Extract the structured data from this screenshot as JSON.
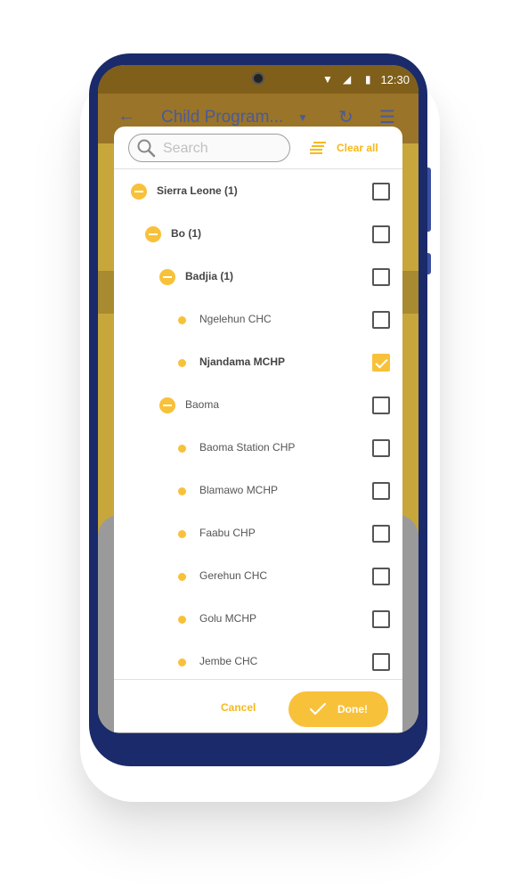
{
  "status_bar": {
    "time": "12:30"
  },
  "background_app": {
    "title": "Child Program..."
  },
  "dialog": {
    "search": {
      "placeholder": "Search",
      "value": ""
    },
    "clear_all_label": "Clear all",
    "tree": [
      {
        "label": "Sierra Leone (1)",
        "level": 0,
        "kind": "expanded",
        "bold": true,
        "checked": false
      },
      {
        "label": "Bo (1)",
        "level": 1,
        "kind": "expanded",
        "bold": true,
        "checked": false
      },
      {
        "label": "Badjia (1)",
        "level": 2,
        "kind": "expanded",
        "bold": true,
        "checked": false
      },
      {
        "label": "Ngelehun CHC",
        "level": 3,
        "kind": "leaf",
        "bold": false,
        "checked": false
      },
      {
        "label": "Njandama MCHP",
        "level": 3,
        "kind": "leaf",
        "bold": true,
        "checked": true
      },
      {
        "label": "Baoma",
        "level": 2,
        "kind": "expanded",
        "bold": false,
        "checked": false
      },
      {
        "label": "Baoma Station CHP",
        "level": 3,
        "kind": "leaf",
        "bold": false,
        "checked": false
      },
      {
        "label": "Blamawo MCHP",
        "level": 3,
        "kind": "leaf",
        "bold": false,
        "checked": false
      },
      {
        "label": "Faabu CHP",
        "level": 3,
        "kind": "leaf",
        "bold": false,
        "checked": false
      },
      {
        "label": "Gerehun CHC",
        "level": 3,
        "kind": "leaf",
        "bold": false,
        "checked": false
      },
      {
        "label": "Golu MCHP",
        "level": 3,
        "kind": "leaf",
        "bold": false,
        "checked": false
      },
      {
        "label": "Jembe CHC",
        "level": 3,
        "kind": "leaf",
        "bold": false,
        "checked": false
      }
    ],
    "cancel_label": "Cancel",
    "done_label": "Done!"
  },
  "colors": {
    "accent": "#f8c13a",
    "accent_text": "#f5b91c",
    "phone_frame": "#1a2a6a"
  }
}
